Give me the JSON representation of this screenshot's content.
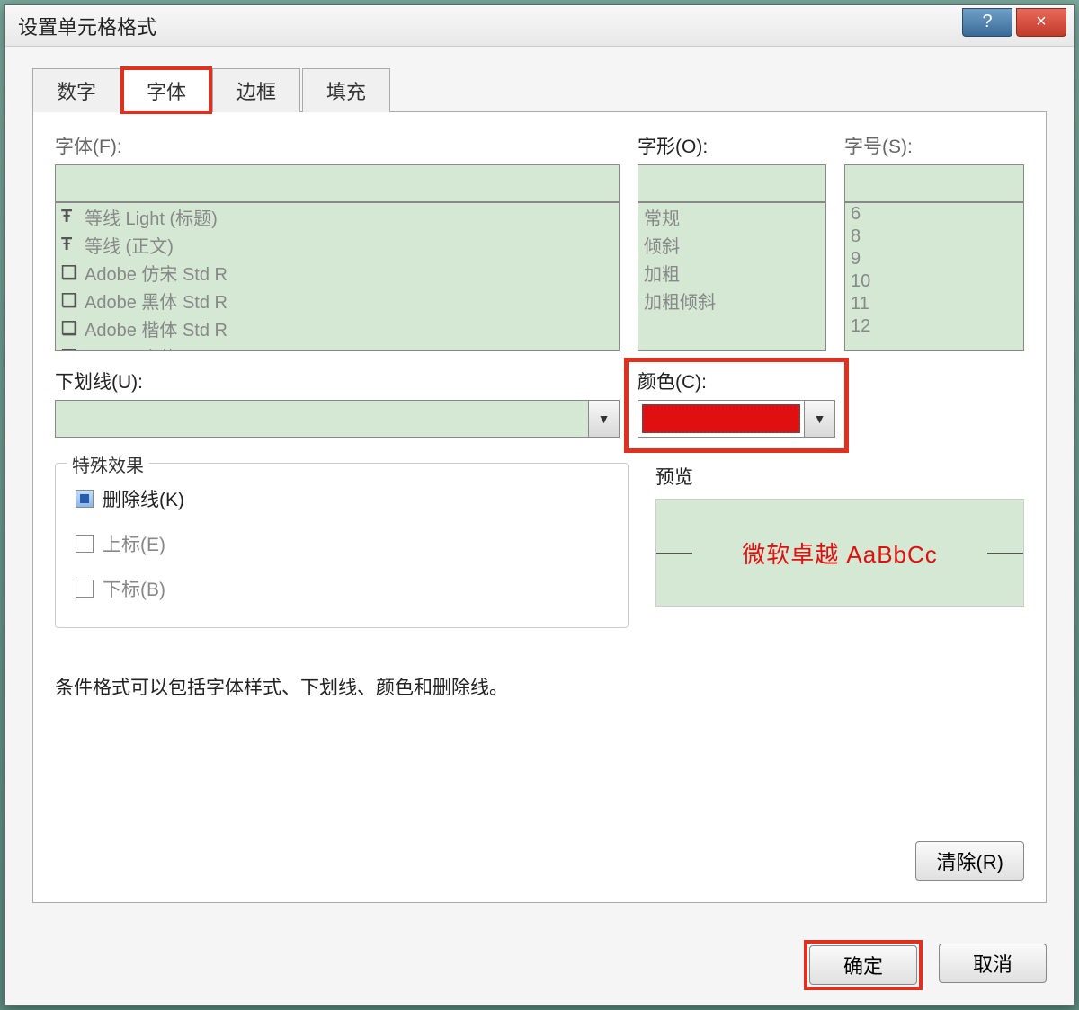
{
  "window": {
    "title": "设置单元格格式",
    "help": "?",
    "close": "×"
  },
  "tabs": {
    "number": "数字",
    "font": "字体",
    "border": "边框",
    "fill": "填充"
  },
  "labels": {
    "font": "字体(F):",
    "style": "字形(O):",
    "size": "字号(S):",
    "underline": "下划线(U):",
    "color": "颜色(C):",
    "effects": "特殊效果",
    "preview": "预览"
  },
  "fonts": [
    "等线 Light (标题)",
    "等线 (正文)",
    "Adobe 仿宋 Std R",
    "Adobe 黑体 Std R",
    "Adobe 楷体 Std R",
    "Adobe 宋体 Std L"
  ],
  "styles": [
    "常规",
    "倾斜",
    "加粗",
    "加粗倾斜"
  ],
  "sizes": [
    "6",
    "8",
    "9",
    "10",
    "11",
    "12"
  ],
  "effects": {
    "strikethrough": "删除线(K)",
    "superscript": "上标(E)",
    "subscript": "下标(B)"
  },
  "preview_text": "微软卓越  AaBbCc",
  "note": "条件格式可以包括字体样式、下划线、颜色和删除线。",
  "buttons": {
    "clear": "清除(R)",
    "ok": "确定",
    "cancel": "取消"
  },
  "color_value": "#e01010"
}
